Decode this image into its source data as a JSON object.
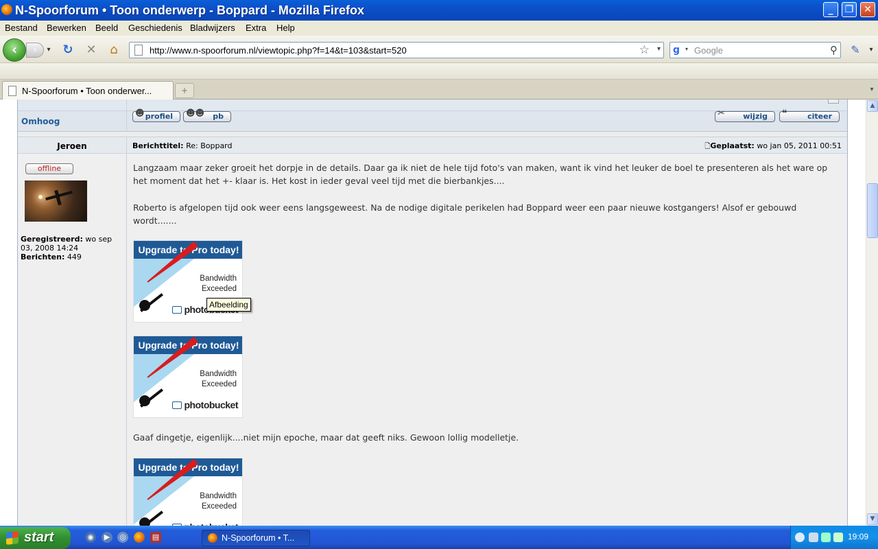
{
  "window": {
    "title": "N-Spoorforum • Toon onderwerp - Boppard - Mozilla Firefox",
    "minimize_icon": "minimize-icon",
    "maximize_icon": "restore-icon",
    "close_icon": "close-icon"
  },
  "menu": [
    "Bestand",
    "Bewerken",
    "Beeld",
    "Geschiedenis",
    "Bladwijzers",
    "Extra",
    "Help"
  ],
  "nav": {
    "url": "http://www.n-spoorforum.nl/viewtopic.php?f=14&t=103&start=520",
    "search_placeholder": "Google"
  },
  "tabs": [
    {
      "label": "N-Spoorforum • Toon onderwer...",
      "active": true
    }
  ],
  "newtab_label": "+",
  "forum": {
    "omhoog": "Omhoog",
    "buttons": {
      "profiel": "profiel",
      "pb": "pb",
      "wijzig": "wijzig",
      "citeer": "citeer"
    },
    "post": {
      "author": "Jeroen",
      "subject_label": "Berichttitel:",
      "subject": "Re: Boppard",
      "posted_label": "Geplaatst:",
      "posted": "wo jan 05, 2011 00:51",
      "status": "offline",
      "registered_label": "Geregistreerd:",
      "registered": "wo sep 03, 2008 14:24",
      "posts_label": "Berichten:",
      "posts": "449",
      "paragraph1": "Langzaam maar zeker groeit het dorpje in de details. Daar ga ik niet de hele tijd foto's van maken, want ik vind het leuker de boel te presenteren als het ware op het moment dat het +- klaar is. Het kost in ieder geval veel tijd met die bierbankjes....",
      "paragraph2": "Roberto is afgelopen tijd ook weer eens langsgeweest. Na de nodige digitale perikelen had Boppard weer een paar nieuwe kostgangers! Alsof er gebouwd wordt.......",
      "paragraph3": "Gaaf dingetje, eigenlijk....niet mijn epoche, maar dat geeft niks. Gewoon lollig modelletje."
    },
    "placeholder_image": {
      "header": "Upgrade to Pro today!",
      "line1": "Bandwidth",
      "line2": "Exceeded",
      "logo": "photobucket"
    },
    "tooltip": "Afbeelding"
  },
  "taskbar": {
    "start": "start",
    "task_item": "N-Spoorforum • T...",
    "clock": "19:09"
  }
}
